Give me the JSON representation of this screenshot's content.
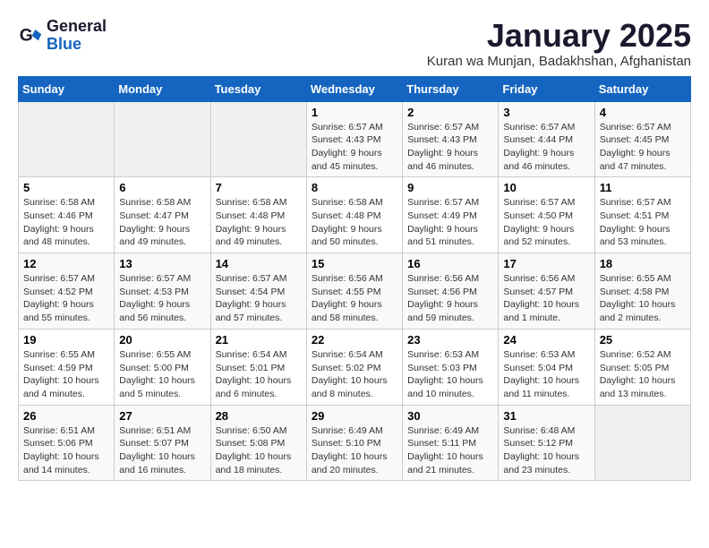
{
  "logo": {
    "line1": "General",
    "line2": "Blue"
  },
  "title": "January 2025",
  "location": "Kuran wa Munjan, Badakhshan, Afghanistan",
  "weekdays": [
    "Sunday",
    "Monday",
    "Tuesday",
    "Wednesday",
    "Thursday",
    "Friday",
    "Saturday"
  ],
  "weeks": [
    [
      {
        "day": "",
        "info": ""
      },
      {
        "day": "",
        "info": ""
      },
      {
        "day": "",
        "info": ""
      },
      {
        "day": "1",
        "info": "Sunrise: 6:57 AM\nSunset: 4:43 PM\nDaylight: 9 hours and 45 minutes."
      },
      {
        "day": "2",
        "info": "Sunrise: 6:57 AM\nSunset: 4:43 PM\nDaylight: 9 hours and 46 minutes."
      },
      {
        "day": "3",
        "info": "Sunrise: 6:57 AM\nSunset: 4:44 PM\nDaylight: 9 hours and 46 minutes."
      },
      {
        "day": "4",
        "info": "Sunrise: 6:57 AM\nSunset: 4:45 PM\nDaylight: 9 hours and 47 minutes."
      }
    ],
    [
      {
        "day": "5",
        "info": "Sunrise: 6:58 AM\nSunset: 4:46 PM\nDaylight: 9 hours and 48 minutes."
      },
      {
        "day": "6",
        "info": "Sunrise: 6:58 AM\nSunset: 4:47 PM\nDaylight: 9 hours and 49 minutes."
      },
      {
        "day": "7",
        "info": "Sunrise: 6:58 AM\nSunset: 4:48 PM\nDaylight: 9 hours and 49 minutes."
      },
      {
        "day": "8",
        "info": "Sunrise: 6:58 AM\nSunset: 4:48 PM\nDaylight: 9 hours and 50 minutes."
      },
      {
        "day": "9",
        "info": "Sunrise: 6:57 AM\nSunset: 4:49 PM\nDaylight: 9 hours and 51 minutes."
      },
      {
        "day": "10",
        "info": "Sunrise: 6:57 AM\nSunset: 4:50 PM\nDaylight: 9 hours and 52 minutes."
      },
      {
        "day": "11",
        "info": "Sunrise: 6:57 AM\nSunset: 4:51 PM\nDaylight: 9 hours and 53 minutes."
      }
    ],
    [
      {
        "day": "12",
        "info": "Sunrise: 6:57 AM\nSunset: 4:52 PM\nDaylight: 9 hours and 55 minutes."
      },
      {
        "day": "13",
        "info": "Sunrise: 6:57 AM\nSunset: 4:53 PM\nDaylight: 9 hours and 56 minutes."
      },
      {
        "day": "14",
        "info": "Sunrise: 6:57 AM\nSunset: 4:54 PM\nDaylight: 9 hours and 57 minutes."
      },
      {
        "day": "15",
        "info": "Sunrise: 6:56 AM\nSunset: 4:55 PM\nDaylight: 9 hours and 58 minutes."
      },
      {
        "day": "16",
        "info": "Sunrise: 6:56 AM\nSunset: 4:56 PM\nDaylight: 9 hours and 59 minutes."
      },
      {
        "day": "17",
        "info": "Sunrise: 6:56 AM\nSunset: 4:57 PM\nDaylight: 10 hours and 1 minute."
      },
      {
        "day": "18",
        "info": "Sunrise: 6:55 AM\nSunset: 4:58 PM\nDaylight: 10 hours and 2 minutes."
      }
    ],
    [
      {
        "day": "19",
        "info": "Sunrise: 6:55 AM\nSunset: 4:59 PM\nDaylight: 10 hours and 4 minutes."
      },
      {
        "day": "20",
        "info": "Sunrise: 6:55 AM\nSunset: 5:00 PM\nDaylight: 10 hours and 5 minutes."
      },
      {
        "day": "21",
        "info": "Sunrise: 6:54 AM\nSunset: 5:01 PM\nDaylight: 10 hours and 6 minutes."
      },
      {
        "day": "22",
        "info": "Sunrise: 6:54 AM\nSunset: 5:02 PM\nDaylight: 10 hours and 8 minutes."
      },
      {
        "day": "23",
        "info": "Sunrise: 6:53 AM\nSunset: 5:03 PM\nDaylight: 10 hours and 10 minutes."
      },
      {
        "day": "24",
        "info": "Sunrise: 6:53 AM\nSunset: 5:04 PM\nDaylight: 10 hours and 11 minutes."
      },
      {
        "day": "25",
        "info": "Sunrise: 6:52 AM\nSunset: 5:05 PM\nDaylight: 10 hours and 13 minutes."
      }
    ],
    [
      {
        "day": "26",
        "info": "Sunrise: 6:51 AM\nSunset: 5:06 PM\nDaylight: 10 hours and 14 minutes."
      },
      {
        "day": "27",
        "info": "Sunrise: 6:51 AM\nSunset: 5:07 PM\nDaylight: 10 hours and 16 minutes."
      },
      {
        "day": "28",
        "info": "Sunrise: 6:50 AM\nSunset: 5:08 PM\nDaylight: 10 hours and 18 minutes."
      },
      {
        "day": "29",
        "info": "Sunrise: 6:49 AM\nSunset: 5:10 PM\nDaylight: 10 hours and 20 minutes."
      },
      {
        "day": "30",
        "info": "Sunrise: 6:49 AM\nSunset: 5:11 PM\nDaylight: 10 hours and 21 minutes."
      },
      {
        "day": "31",
        "info": "Sunrise: 6:48 AM\nSunset: 5:12 PM\nDaylight: 10 hours and 23 minutes."
      },
      {
        "day": "",
        "info": ""
      }
    ]
  ]
}
